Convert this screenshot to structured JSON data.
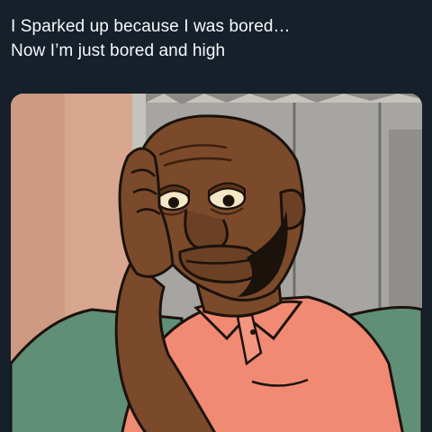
{
  "tweet": {
    "text_lines": [
      "I Sparked up because I was bored…",
      "Now I’m just bored and high"
    ]
  },
  "media": {
    "colors": {
      "wall": "#d9a690",
      "wall_shade": "#c8937f",
      "door": "#a6a5a2",
      "door_trim": "#c4c3bc",
      "couch": "#5f8f77",
      "skin": "#7a4a2a",
      "skin_dark": "#5b3319",
      "shirt": "#f08a72",
      "outline": "#1c120c",
      "eye_white": "#f4e7c6"
    }
  }
}
